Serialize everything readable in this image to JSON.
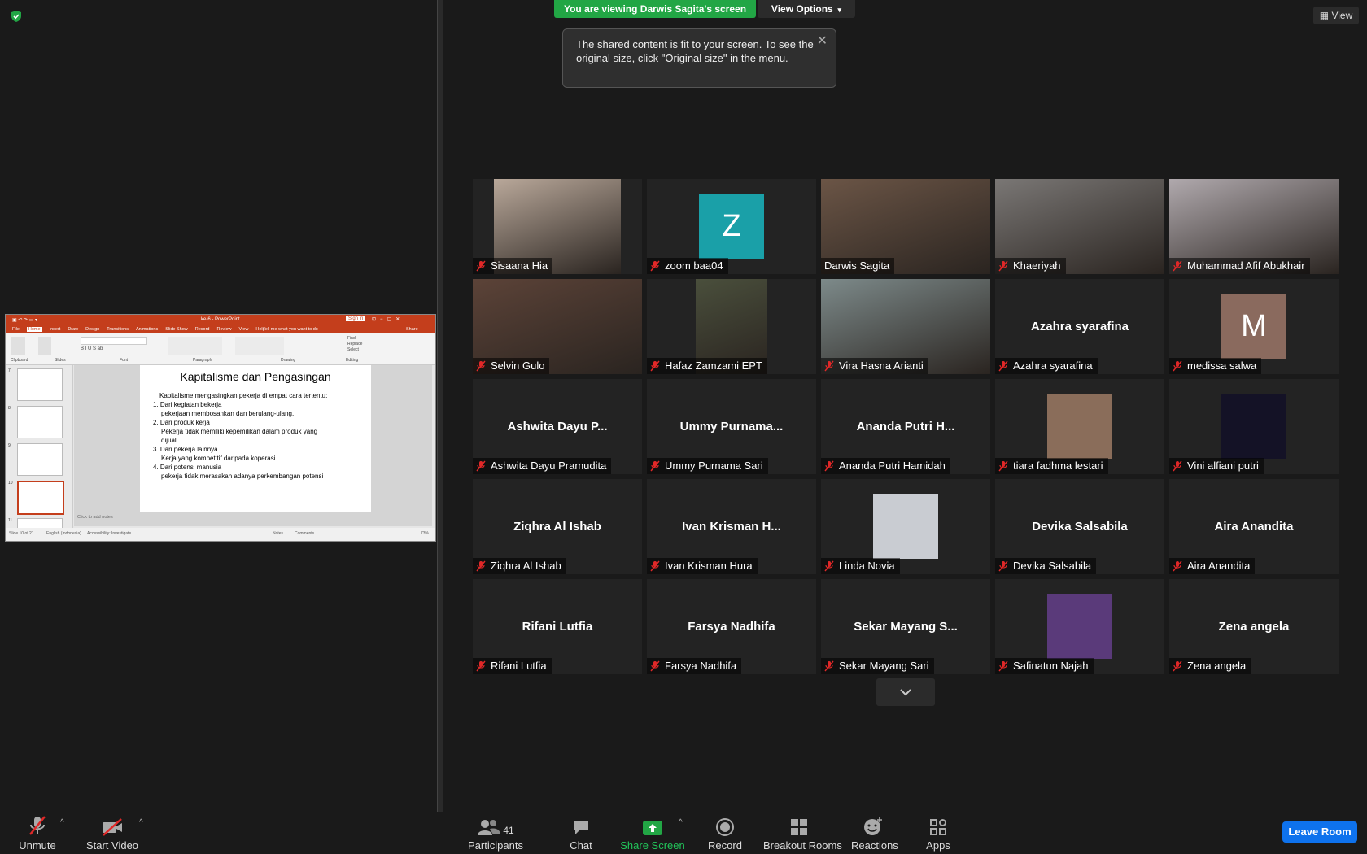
{
  "banner": {
    "viewing": "You are viewing Darwis Sagita's screen",
    "view_options": "View Options"
  },
  "tooltip": {
    "text": "The shared content is fit to your screen. To see the original size, click \"Original size\" in the menu."
  },
  "view_button": "View",
  "ppt": {
    "title": "ke-6 - PowerPoint",
    "sign_in": "Sign in",
    "share": "Share",
    "tabs": [
      "File",
      "Home",
      "Insert",
      "Draw",
      "Design",
      "Transitions",
      "Animations",
      "Slide Show",
      "Record",
      "Review",
      "View",
      "Help"
    ],
    "tell_me": "Tell me what you want to do",
    "ribbon_groups": [
      "Clipboard",
      "Slides",
      "Font",
      "Paragraph",
      "Drawing",
      "Editing"
    ],
    "slide_numbers": [
      "7",
      "8",
      "9",
      "10",
      "11"
    ],
    "slide": {
      "title": "Kapitalisme dan Pengasingan",
      "bullets": [
        "Kapitalisme mengasingkan pekerja di empat cara tertentu:",
        "1. Dari kegiatan bekerja",
        "pekerjaan membosankan dan berulang-ulang.",
        "2. Dari produk kerja",
        "Pekerja tidak memiliki kepemilikan dalam produk yang",
        "dijual",
        "3. Dari pekerja lainnya",
        "Kerja yang kompetitif daripada koperasi.",
        "4. Dari potensi manusia",
        "pekerja tidak merasakan adanya perkembangan potensi"
      ]
    },
    "notes": "Click to add notes",
    "status": "Slide 10 of 21",
    "language": "English (Indonesia)",
    "accessibility": "Accessibility: Investigate",
    "notes_btn": "Notes",
    "comments_btn": "Comments",
    "zoom": "73%"
  },
  "participants": [
    {
      "name": "Sisaana Hia",
      "display": "video",
      "color": "#b9a89a"
    },
    {
      "name": "zoom baa04",
      "display": "avatar",
      "initial": "Z",
      "color": "#1aa0a8"
    },
    {
      "name": "Darwis Sagita",
      "display": "video",
      "color": "#6b5546",
      "active": true
    },
    {
      "name": "Khaeriyah",
      "display": "video",
      "color": "#7a7775"
    },
    {
      "name": "Muhammad Afif Abukhair",
      "display": "video",
      "color": "#b0a9ad"
    },
    {
      "name": "Selvin Gulo",
      "display": "video",
      "color": "#5c4338"
    },
    {
      "name": "Hafaz Zamzami EPT",
      "display": "video",
      "color": "#4a4f3c"
    },
    {
      "name": "Vira Hasna Arianti",
      "display": "video",
      "color": "#7d8a8a"
    },
    {
      "name": "Azahra syarafina",
      "display": "text",
      "center": "Azahra syarafina"
    },
    {
      "name": "medissa salwa",
      "display": "avatar",
      "initial": "M",
      "color": "#8a6a5e"
    },
    {
      "name": "Ashwita Dayu Pramudita",
      "display": "text",
      "center": "Ashwita Dayu P..."
    },
    {
      "name": "Ummy Purnama Sari",
      "display": "text",
      "center": "Ummy Purnama..."
    },
    {
      "name": "Ananda Putri Hamidah",
      "display": "text",
      "center": "Ananda Putri H..."
    },
    {
      "name": "tiara fadhma lestari",
      "display": "photo",
      "color": "#8a6d5a"
    },
    {
      "name": "Vini alfiani putri",
      "display": "photo",
      "color": "#141226"
    },
    {
      "name": "Ziqhra Al Ishab",
      "display": "text",
      "center": "Ziqhra Al Ishab"
    },
    {
      "name": "Ivan Krisman Hura",
      "display": "text",
      "center": "Ivan Krisman H..."
    },
    {
      "name": "Linda Novia",
      "display": "photo",
      "color": "#c9ccd2"
    },
    {
      "name": "Devika Salsabila",
      "display": "text",
      "center": "Devika Salsabila"
    },
    {
      "name": "Aira Anandita",
      "display": "text",
      "center": "Aira Anandita"
    },
    {
      "name": "Rifani Lutfia",
      "display": "text",
      "center": "Rifani Lutfia"
    },
    {
      "name": "Farsya Nadhifa",
      "display": "text",
      "center": "Farsya Nadhifa"
    },
    {
      "name": "Sekar Mayang Sari",
      "display": "text",
      "center": "Sekar Mayang S..."
    },
    {
      "name": "Safinatun Najah",
      "display": "photo",
      "color": "#5a3a7a"
    },
    {
      "name": "Zena angela",
      "display": "text",
      "center": "Zena angela"
    }
  ],
  "toolbar": {
    "unmute": "Unmute",
    "start_video": "Start Video",
    "participants": "Participants",
    "participant_count": "41",
    "chat": "Chat",
    "share_screen": "Share Screen",
    "record": "Record",
    "breakout_rooms": "Breakout Rooms",
    "reactions": "Reactions",
    "apps": "Apps",
    "leave": "Leave Room"
  },
  "colors": {
    "accent_green": "#22a645",
    "leave_blue": "#0e72ed",
    "active_speaker": "#c8e06a",
    "mute_red": "#e02828"
  }
}
